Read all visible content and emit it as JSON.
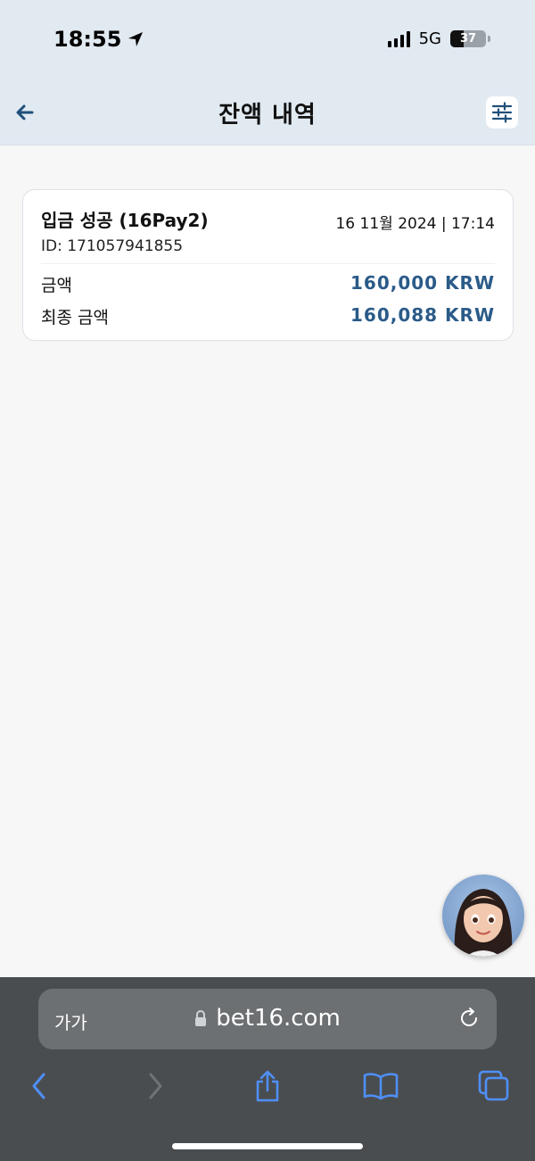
{
  "status_bar": {
    "time": "18:55",
    "network": "5G",
    "battery_level": "37"
  },
  "header": {
    "title": "잔액 내역",
    "back_icon": "arrow-left-icon",
    "filter_icon": "sliders-icon"
  },
  "transaction": {
    "title": "입금 성공 (16Pay2)",
    "date": "16 11월 2024 | 17:14",
    "id_text": "ID: 171057941855",
    "amount_label": "금액",
    "amount_value": "160,000 KRW",
    "final_amount_label": "최종 금액",
    "final_amount_value": "160,088 KRW"
  },
  "browser": {
    "reader_label": "가가",
    "url": "bet16.com",
    "buttons": [
      "back-icon",
      "forward-icon",
      "share-icon",
      "bookmarks-icon",
      "tabs-icon"
    ]
  },
  "colors": {
    "header_bg": "#e1e9f1",
    "accent": "#2b5b88",
    "browser_blue": "#4f8ff7"
  }
}
